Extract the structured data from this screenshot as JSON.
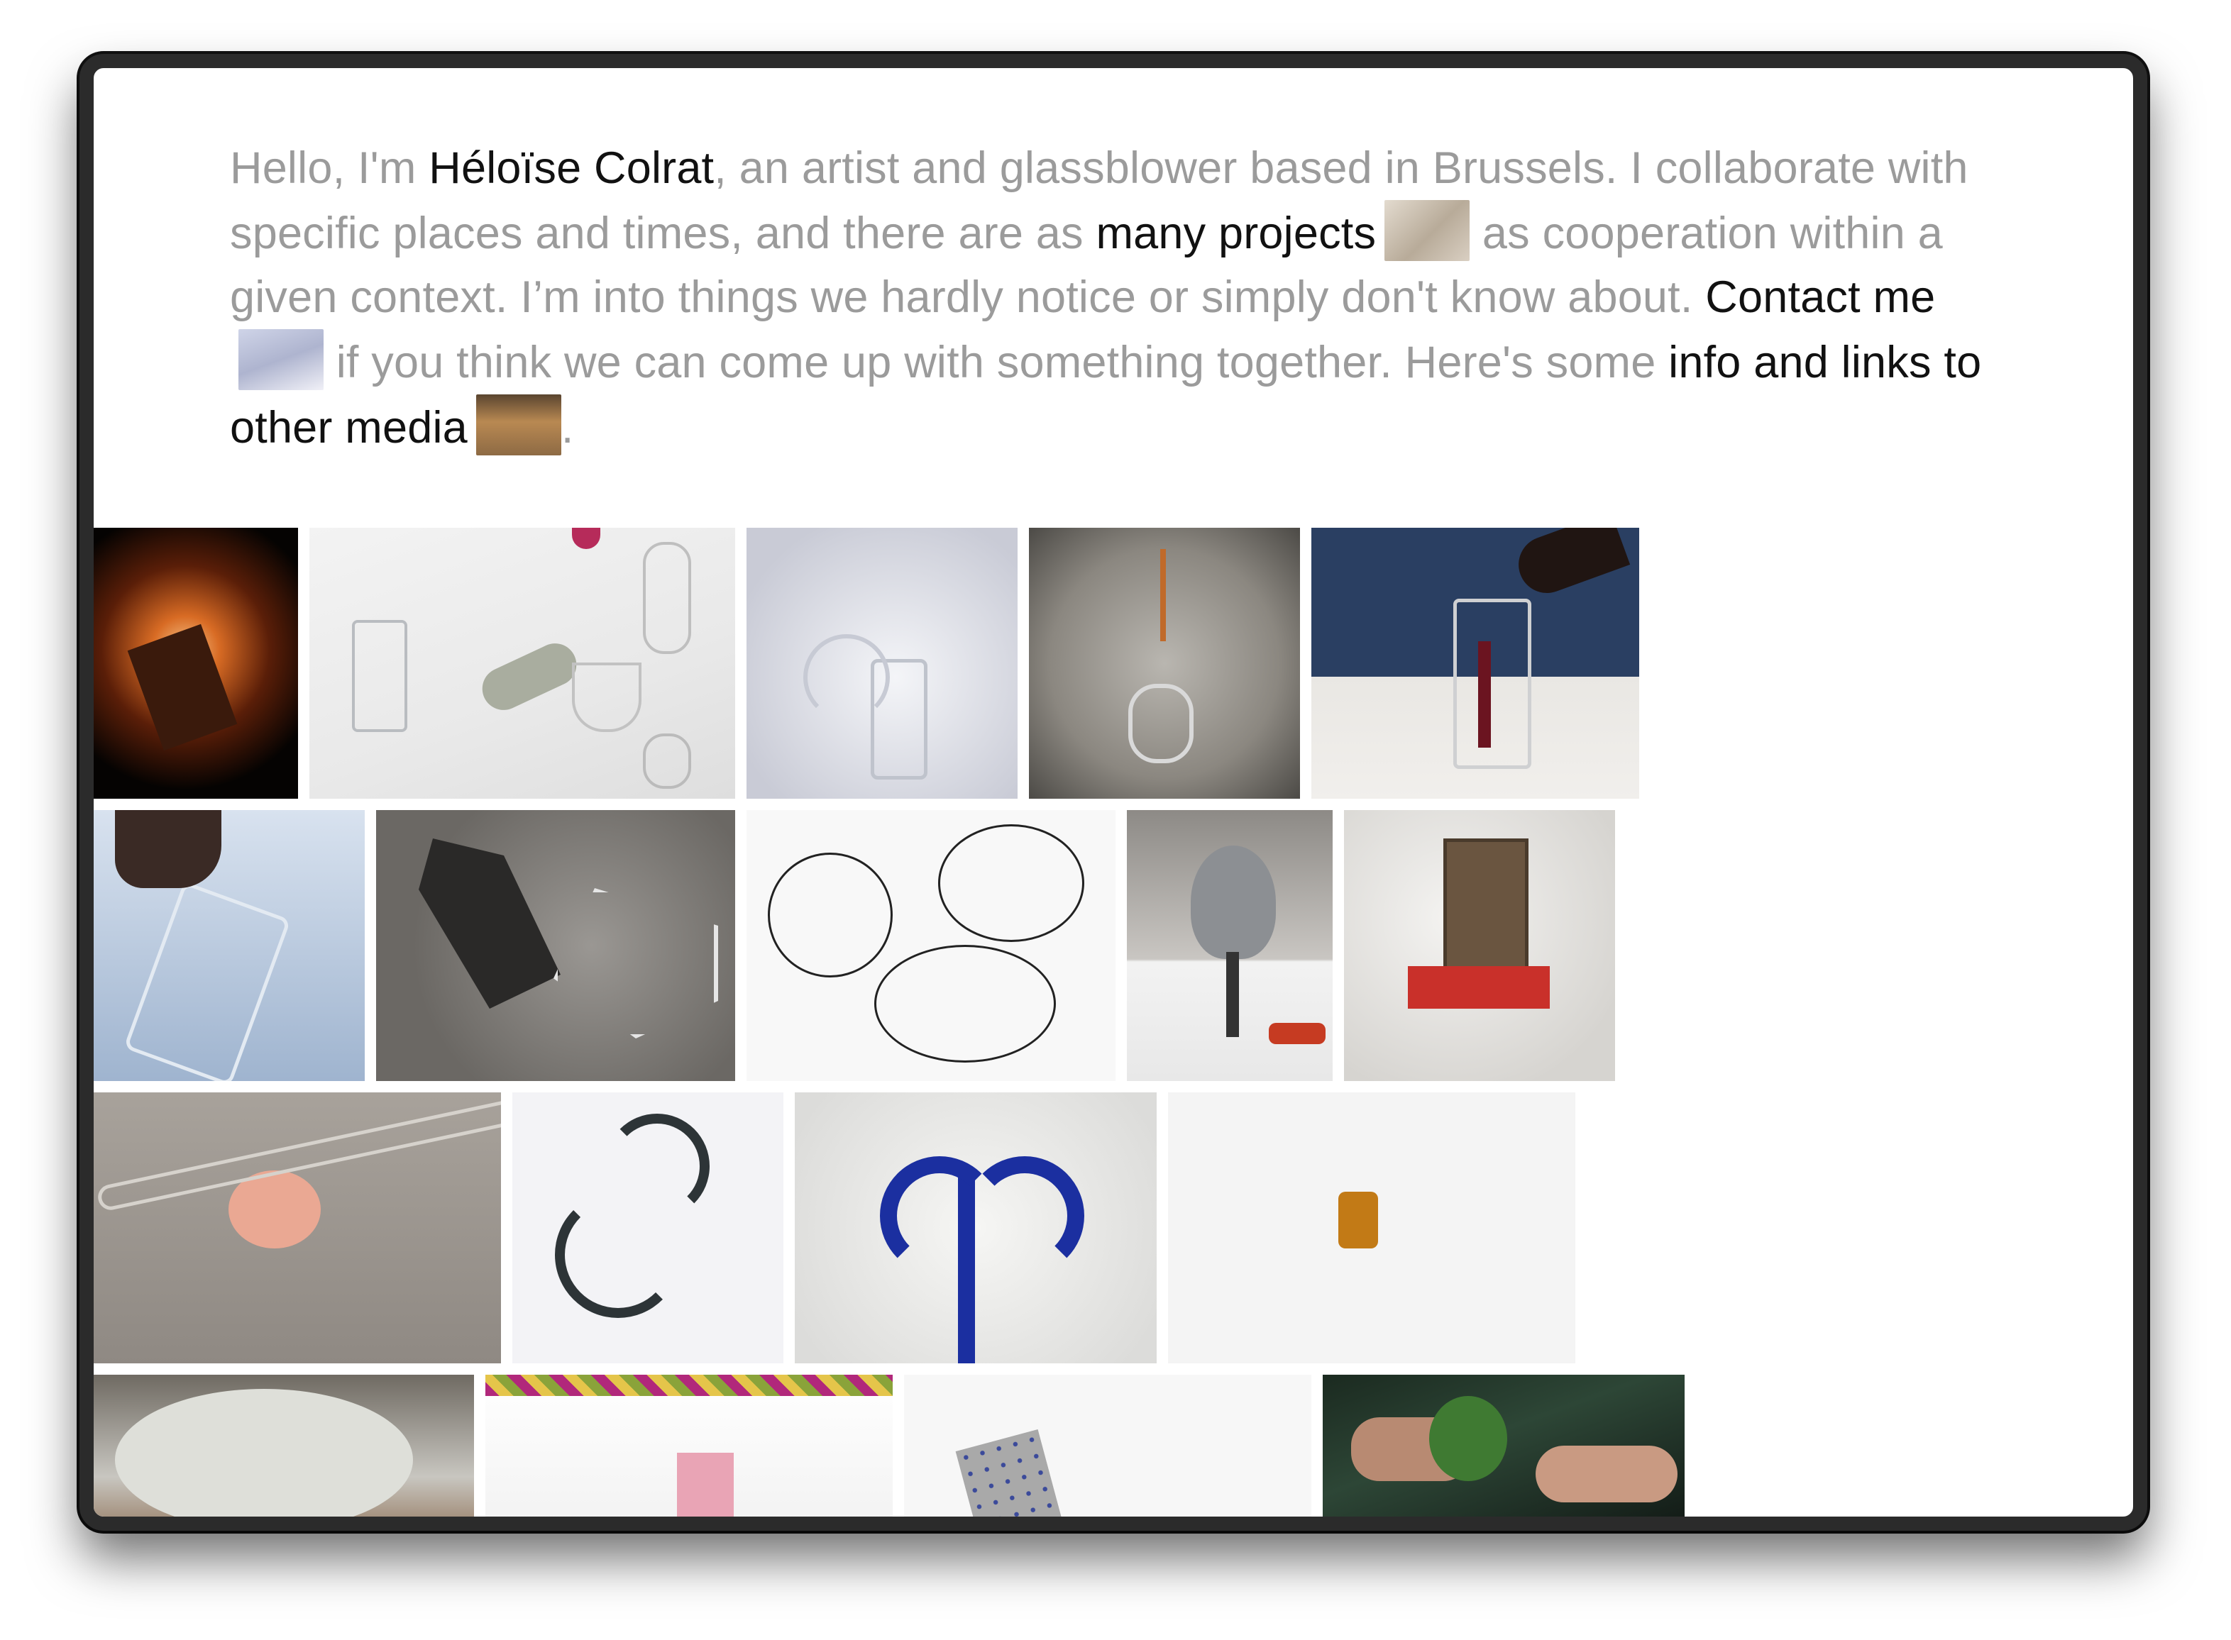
{
  "intro": {
    "part1": "Hello, I'm ",
    "name_link": "Héloïse Colrat",
    "part2": ", an artist and glassblower based in Brussels. I collaborate with specific places and times, and there are as ",
    "projects_link": "many projects",
    "part3": " as cooperation within a given context. I’m into things we hardly notice or simply don't know about. ",
    "contact_link": "Contact me",
    "part4": " if you think we can come up with something together. Here's some ",
    "info_link": "info and links to other media",
    "part5": "."
  },
  "colors": {
    "intro_text": "#9b9b9b",
    "link_text": "#111111",
    "background": "#ffffff"
  },
  "gallery": {
    "rows": 4,
    "tiles": [
      {
        "subject": "molten glass pour"
      },
      {
        "subject": "glassware on table"
      },
      {
        "subject": "curved glass straw"
      },
      {
        "subject": "glass coil on stone"
      },
      {
        "subject": "wine pouring into glass jug"
      },
      {
        "subject": "glass mug held by hand"
      },
      {
        "subject": "faceted glass sculpture"
      },
      {
        "subject": "handwritten diagram"
      },
      {
        "subject": "metal artichoke"
      },
      {
        "subject": "window with red shelf"
      },
      {
        "subject": "glass bubble on tube"
      },
      {
        "subject": "black S hook"
      },
      {
        "subject": "blue glass hook"
      },
      {
        "subject": "amber glass cup"
      },
      {
        "subject": "white ceramic object"
      },
      {
        "subject": "gallery room"
      },
      {
        "subject": "dotted glass ribbon"
      },
      {
        "subject": "hands with small figure"
      }
    ]
  }
}
